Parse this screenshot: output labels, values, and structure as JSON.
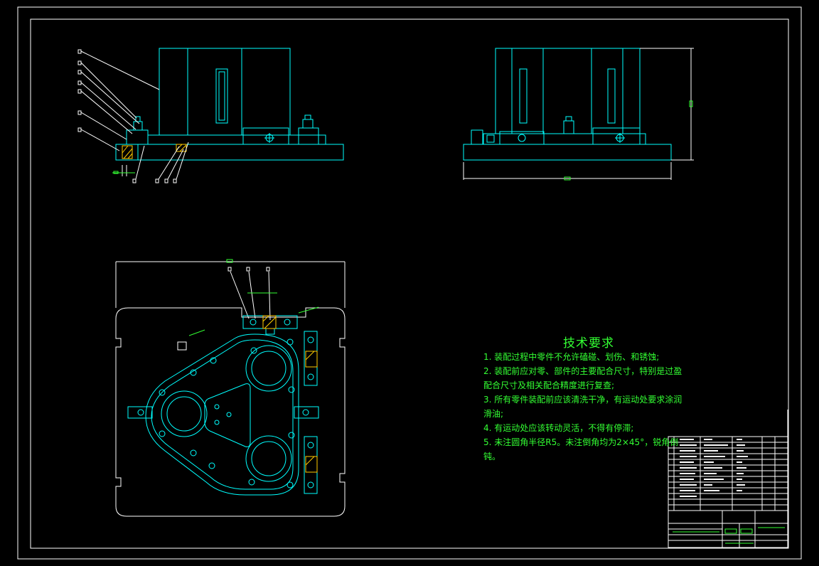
{
  "drawing": {
    "background": "#000000",
    "colors": {
      "border": "#ffffff",
      "geometry": "#00ffff",
      "annotation": "#33ff33",
      "hatch": "#ffcc00",
      "leader": "#ffffff"
    }
  },
  "technical_requirements": {
    "title": "技术要求",
    "lines": [
      "1. 装配过程中零件不允许磕碰、划伤、和锈蚀;",
      "2. 装配前应对零、部件的主要配合尺寸，特别是过盈",
      "配合尺寸及相关配合精度进行复查;",
      "3. 所有零件装配前应该清洗干净，有运动处要求涂润",
      "滑油;",
      "4. 有运动处应该转动灵活，不得有停滞;",
      "5. 未注圆角半径R5。未注倒角均为2×45°，锐角倒",
      "钝。"
    ]
  }
}
